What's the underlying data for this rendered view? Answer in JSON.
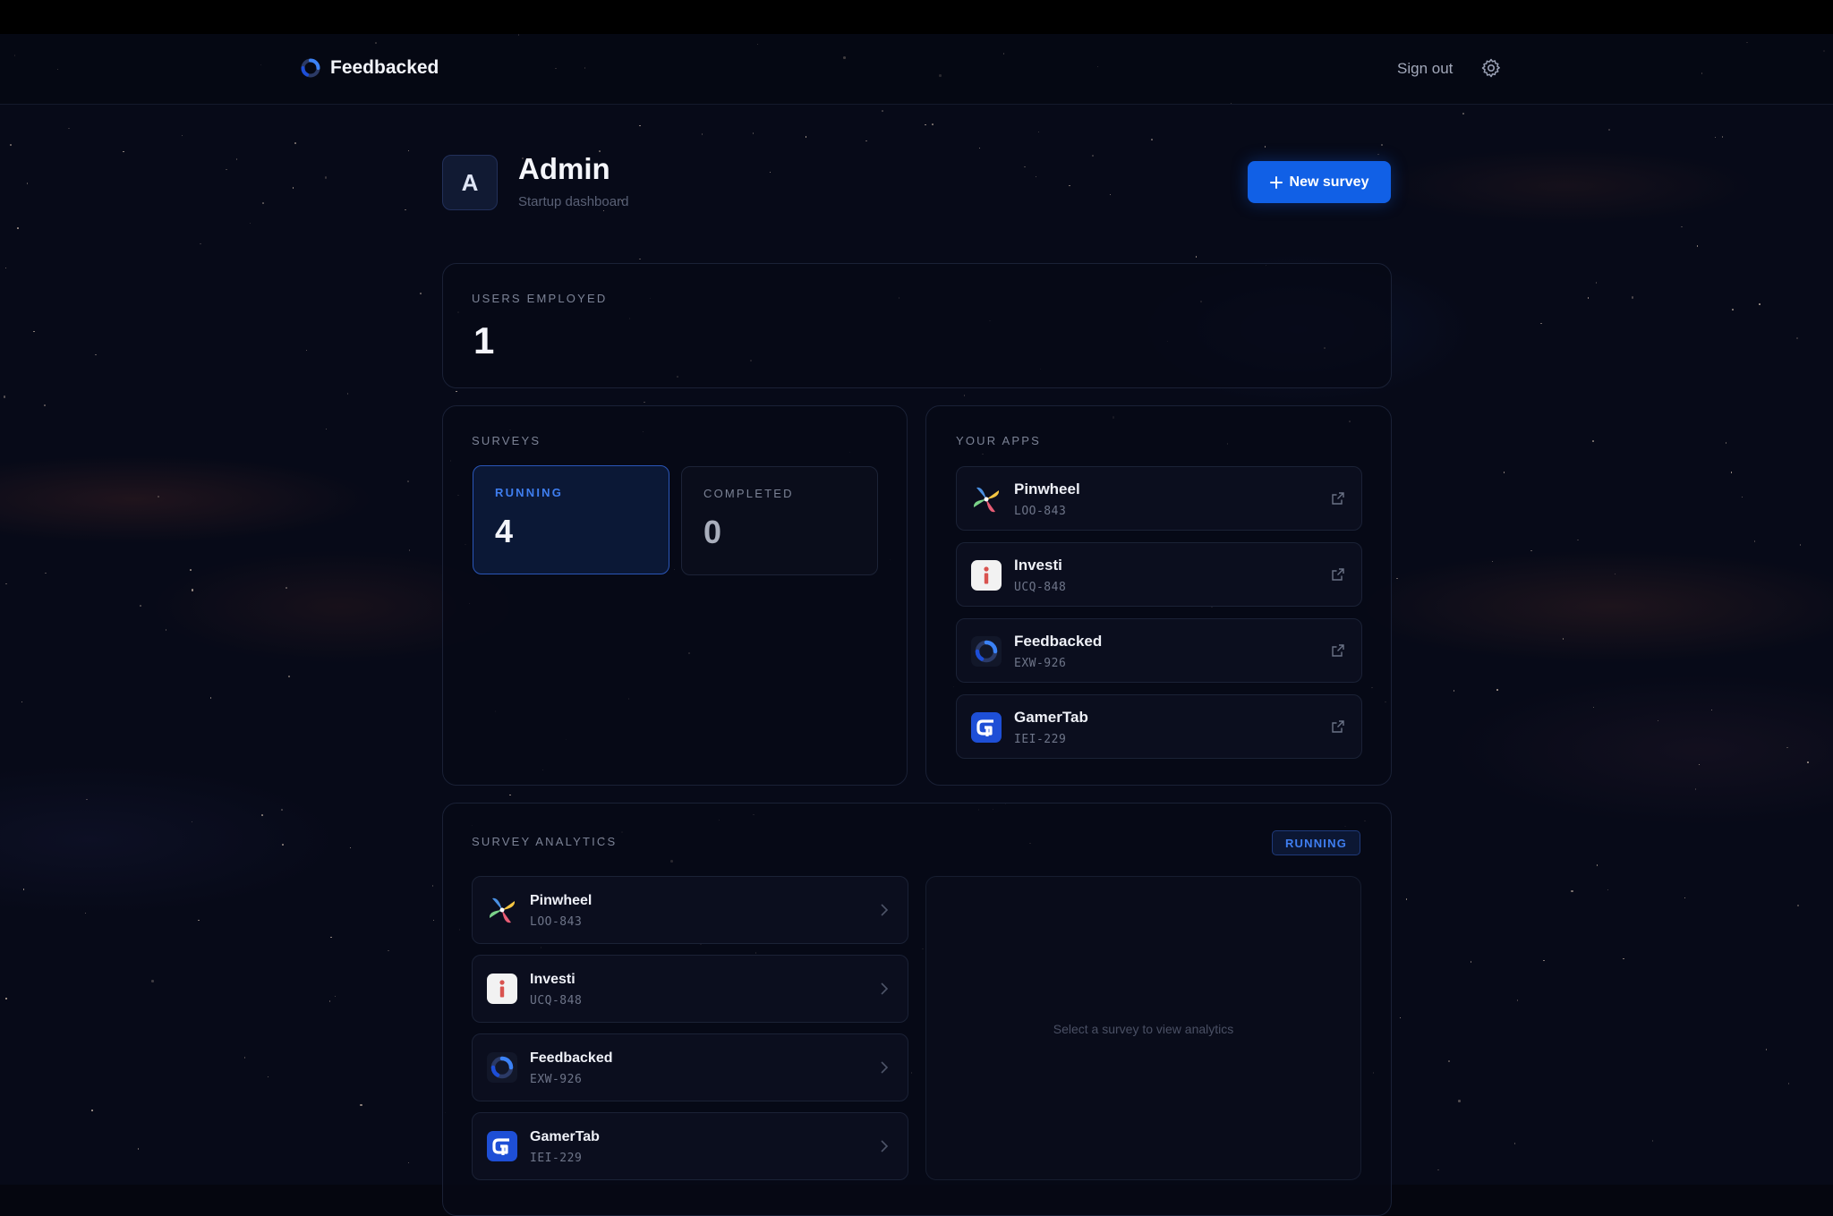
{
  "nav": {
    "brand": "Feedbacked",
    "sign_out": "Sign out"
  },
  "header": {
    "avatar_initial": "A",
    "title": "Admin",
    "subtitle": "Startup dashboard",
    "new_survey_label": "New survey"
  },
  "users_employed": {
    "label": "USERS EMPLOYED",
    "value": "1"
  },
  "surveys": {
    "label": "SURVEYS",
    "running": {
      "label": "RUNNING",
      "value": "4"
    },
    "completed": {
      "label": "COMPLETED",
      "value": "0"
    }
  },
  "your_apps": {
    "label": "YOUR APPS",
    "items": [
      {
        "name": "Pinwheel",
        "code": "LOO-843",
        "icon": "pinwheel-icon"
      },
      {
        "name": "Investi",
        "code": "UCQ-848",
        "icon": "investi-icon"
      },
      {
        "name": "Feedbacked",
        "code": "EXW-926",
        "icon": "feedbacked-icon"
      },
      {
        "name": "GamerTab",
        "code": "IEI-229",
        "icon": "gamertab-icon"
      }
    ]
  },
  "analytics": {
    "label": "SURVEY ANALYTICS",
    "badge": "RUNNING",
    "items": [
      {
        "name": "Pinwheel",
        "code": "LOO-843"
      },
      {
        "name": "Investi",
        "code": "UCQ-848"
      },
      {
        "name": "Feedbacked",
        "code": "EXW-926"
      },
      {
        "name": "GamerTab",
        "code": "IEI-229"
      }
    ],
    "empty_text": "Select a survey to view analytics"
  },
  "colors": {
    "accent": "#1160e6",
    "background": "#070a18",
    "running_text": "#3f7ef0"
  }
}
